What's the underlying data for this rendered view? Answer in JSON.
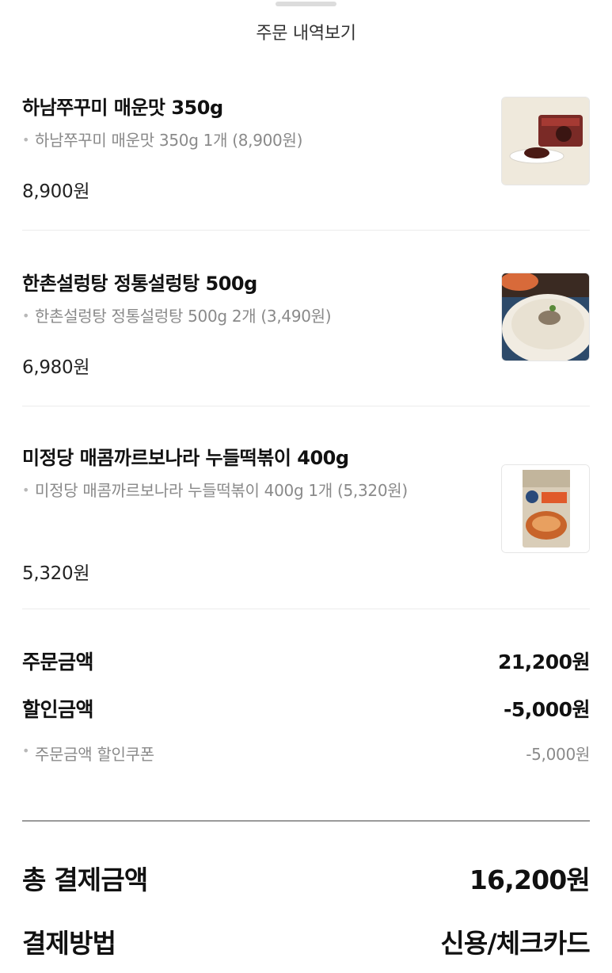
{
  "header": {
    "title": "주문 내역보기"
  },
  "items": [
    {
      "name": "하남쭈꾸미 매운맛 350g",
      "option": "하남쭈꾸미 매운맛 350g 1개 (8,900원)",
      "price": "8,900원",
      "image": "jjukkumi-product-photo"
    },
    {
      "name": "한촌설렁탕 정통설렁탕 500g",
      "option": "한촌설렁탕 정통설렁탕 500g 2개 (3,490원)",
      "price": "6,980원",
      "image": "seolleongtang-bowl-photo"
    },
    {
      "name": "미정당 매콤까르보나라 누들떡볶이 400g",
      "option": "미정당 매콤까르보나라 누들떡볶이 400g 1개 (5,320원)",
      "price": "5,320원",
      "image": "tteokbokki-package-photo"
    }
  ],
  "summary": {
    "order_amount_label": "주문금액",
    "order_amount_value": "21,200원",
    "discount_label": "할인금액",
    "discount_value": "-5,000원",
    "coupon_label": "주문금액 할인쿠폰",
    "coupon_value": "-5,000원",
    "total_label": "총 결제금액",
    "total_value": "16,200원",
    "method_label": "결제방법",
    "method_value": "신용/체크카드"
  },
  "colors": {
    "text_primary": "#111111",
    "text_secondary": "#8a8a8a",
    "divider": "#ececec"
  }
}
